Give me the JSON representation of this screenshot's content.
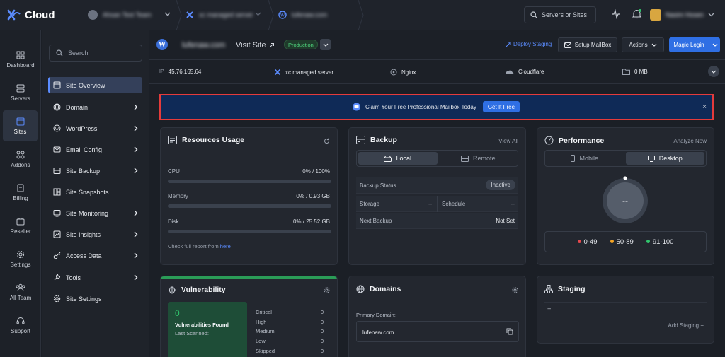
{
  "brand": {
    "name": "Cloud"
  },
  "topbar": {
    "breadcrumbs": [
      {
        "label": "Ahsan Test Team"
      },
      {
        "label": "xc managed server"
      },
      {
        "label": "lufenaw.com"
      }
    ],
    "search_label": "Servers or Sites",
    "user_name": "Nasim Hosen"
  },
  "rail": [
    {
      "label": "Dashboard",
      "icon": "dashboard-icon"
    },
    {
      "label": "Servers",
      "icon": "servers-icon"
    },
    {
      "label": "Sites",
      "icon": "sites-icon",
      "active": true
    },
    {
      "label": "Addons",
      "icon": "addons-icon"
    },
    {
      "label": "Billing",
      "icon": "billing-icon"
    },
    {
      "label": "Reseller",
      "icon": "reseller-icon"
    },
    {
      "label": "Settings",
      "icon": "settings-icon"
    },
    {
      "label": "All Team",
      "icon": "team-icon"
    },
    {
      "label": "Support",
      "icon": "support-icon"
    }
  ],
  "sidemenu": {
    "search_placeholder": "Search",
    "items": [
      {
        "label": "Site Overview",
        "active": true,
        "has_children": false
      },
      {
        "label": "Domain",
        "has_children": true
      },
      {
        "label": "WordPress",
        "has_children": true
      },
      {
        "label": "Email Config",
        "has_children": true
      },
      {
        "label": "Site Backup",
        "has_children": true
      },
      {
        "label": "Site Snapshots",
        "has_children": false
      },
      {
        "label": "Site Monitoring",
        "has_children": true
      },
      {
        "label": "Site Insights",
        "has_children": true
      },
      {
        "label": "Access Data",
        "has_children": true
      },
      {
        "label": "Tools",
        "has_children": true
      },
      {
        "label": "Site Settings",
        "has_children": false
      }
    ]
  },
  "site": {
    "name": "lufenaw.com",
    "visit_label": "Visit Site",
    "environment": "Production",
    "deploy_staging": "Deploy Staging",
    "setup_mailbox": "Setup MailBox",
    "actions": "Actions",
    "magic_login": "Magic Login"
  },
  "info": {
    "ip_label": "IP",
    "ip": "45.76.165.64",
    "server": "xc managed server",
    "webserver": "Nginx",
    "cdn": "Cloudflare",
    "disk": "0 MB"
  },
  "promo": {
    "text": "Claim Your Free Professional Mailbox Today",
    "button": "Get It Free",
    "close": "×"
  },
  "resources": {
    "title": "Resources Usage",
    "rows": [
      {
        "label": "CPU",
        "value": "0% / 100%",
        "fraction": 0
      },
      {
        "label": "Memory",
        "value": "0% / 0.93 GB",
        "fraction": 0
      },
      {
        "label": "Disk",
        "value": "0% / 25.52 GB",
        "fraction": 0
      }
    ],
    "footer_text": "Check full report from",
    "footer_link": "here"
  },
  "backup": {
    "title": "Backup",
    "view_all": "View All",
    "tabs": [
      "Local",
      "Remote"
    ],
    "status_label": "Backup Status",
    "status_value": "Inactive",
    "storage_label": "Storage",
    "storage_value": "--",
    "schedule_label": "Schedule",
    "schedule_value": "--",
    "next_label": "Next Backup",
    "next_value": "Not Set"
  },
  "performance": {
    "title": "Performance",
    "analyze": "Analyze Now",
    "tabs": [
      "Mobile",
      "Desktop"
    ],
    "score": "--",
    "legend": [
      {
        "label": "0-49",
        "color": "#e5484d"
      },
      {
        "label": "50-89",
        "color": "#f5a524"
      },
      {
        "label": "91-100",
        "color": "#30c46c"
      }
    ]
  },
  "vulnerability": {
    "title": "Vulnerability",
    "count": "0",
    "found_label": "Vulnerabilities Found",
    "scanned_label": "Last Scanned:",
    "rows": [
      {
        "label": "Critical",
        "value": "0"
      },
      {
        "label": "High",
        "value": "0"
      },
      {
        "label": "Medium",
        "value": "0"
      },
      {
        "label": "Low",
        "value": "0"
      },
      {
        "label": "Skipped",
        "value": "0"
      }
    ]
  },
  "domains": {
    "title": "Domains",
    "primary_label": "Primary Domain:",
    "primary_value": "lufenaw.com"
  },
  "staging": {
    "title": "Staging",
    "value": "--",
    "add_label": "Add Staging +"
  }
}
